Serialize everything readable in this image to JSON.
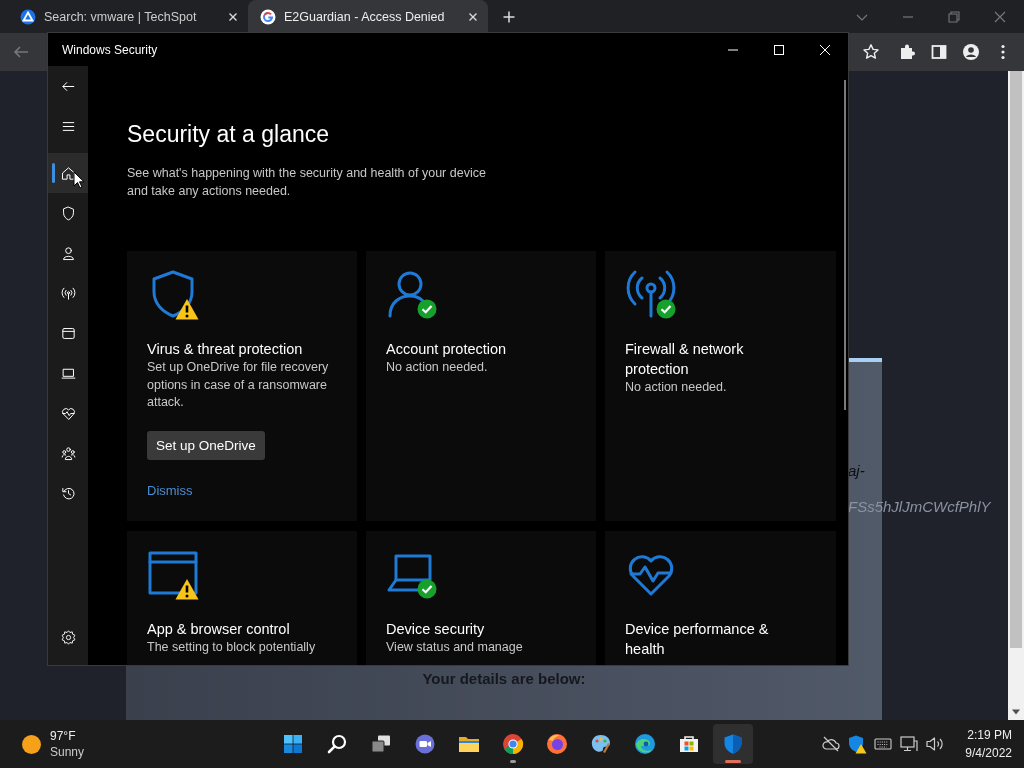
{
  "browser": {
    "tabs": [
      {
        "title": "Search: vmware | TechSpot",
        "selected": false
      },
      {
        "title": "E2Guardian - Access Denied",
        "selected": true
      }
    ],
    "page": {
      "fragment_1": "aj-",
      "fragment_2": "FSs5hJlJmCWcfPhlY",
      "details_heading": "Your details are below:"
    }
  },
  "security_window": {
    "title": "Windows Security",
    "nav_items": [
      {
        "kind": "home",
        "selected": true
      },
      {
        "kind": "shield",
        "selected": false
      },
      {
        "kind": "person",
        "selected": false
      },
      {
        "kind": "antenna",
        "selected": false
      },
      {
        "kind": "window",
        "selected": false
      },
      {
        "kind": "laptop",
        "selected": false
      },
      {
        "kind": "heart",
        "selected": false
      },
      {
        "kind": "family",
        "selected": false
      },
      {
        "kind": "history",
        "selected": false
      }
    ],
    "heading": "Security at a glance",
    "subtitle": "See what's happening with the security and health of your device and take any actions needed.",
    "cards": [
      {
        "kind": "shield",
        "warning": true,
        "healthy": false,
        "title": "Virus & threat protection",
        "description": "Set up OneDrive for file recovery options in case of a ransomware attack.",
        "button": "Set up OneDrive",
        "link": "Dismiss"
      },
      {
        "kind": "person",
        "warning": false,
        "healthy": true,
        "title": "Account protection",
        "description": "No action needed."
      },
      {
        "kind": "antenna",
        "warning": false,
        "healthy": true,
        "title": "Firewall & network protection",
        "description": "No action needed."
      },
      {
        "kind": "window",
        "warning": true,
        "healthy": false,
        "title": "App & browser control",
        "description": "The setting to block potentially"
      },
      {
        "kind": "laptop",
        "warning": false,
        "healthy": true,
        "title": "Device security",
        "description": "View status and manage"
      },
      {
        "kind": "heart",
        "warning": false,
        "healthy": false,
        "title": "Device performance & health"
      }
    ]
  },
  "taskbar": {
    "weather": {
      "temperature": "97°F",
      "condition": "Sunny"
    },
    "apps": [
      {
        "kind": "start",
        "running": false,
        "selected": false
      },
      {
        "kind": "search",
        "running": false,
        "selected": false
      },
      {
        "kind": "taskview",
        "running": false,
        "selected": false
      },
      {
        "kind": "chat",
        "running": false,
        "selected": false
      },
      {
        "kind": "folder",
        "running": false,
        "selected": false
      },
      {
        "kind": "chrome",
        "running": true,
        "selected": false
      },
      {
        "kind": "firefox",
        "running": false,
        "selected": false
      },
      {
        "kind": "palette",
        "running": false,
        "selected": false
      },
      {
        "kind": "edge",
        "running": false,
        "selected": false
      },
      {
        "kind": "store",
        "running": false,
        "selected": false
      },
      {
        "kind": "security",
        "running": true,
        "selected": true
      }
    ],
    "time": "2:19 PM",
    "date": "9/4/2022"
  }
}
